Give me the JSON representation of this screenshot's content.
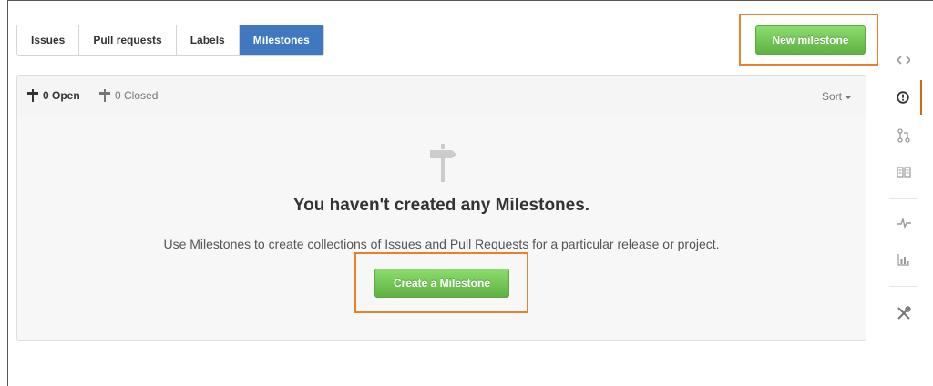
{
  "tabs": [
    {
      "label": "Issues",
      "active": false
    },
    {
      "label": "Pull requests",
      "active": false
    },
    {
      "label": "Labels",
      "active": false
    },
    {
      "label": "Milestones",
      "active": true
    }
  ],
  "new_milestone_label": "New milestone",
  "filter": {
    "open_label": "0 Open",
    "closed_label": "0 Closed",
    "sort_label": "Sort"
  },
  "blankslate": {
    "heading": "You haven't created any Milestones.",
    "description": "Use Milestones to create collections of Issues and Pull Requests for a particular release or project.",
    "button_label": "Create a Milestone"
  },
  "sidebar": {
    "items": [
      {
        "icon": "code-icon",
        "selected": false
      },
      {
        "icon": "issue-opened-icon",
        "selected": true
      },
      {
        "icon": "git-pull-request-icon",
        "selected": false
      },
      {
        "icon": "book-icon",
        "selected": false
      },
      {
        "icon": "pulse-icon",
        "selected": false
      },
      {
        "icon": "graph-icon",
        "selected": false
      },
      {
        "icon": "tools-icon",
        "selected": false
      }
    ]
  },
  "colors": {
    "tab_active_bg": "#4078c0",
    "button_green": "#60b044",
    "highlight": "#e8812e",
    "selected_indicator": "#d26911"
  }
}
